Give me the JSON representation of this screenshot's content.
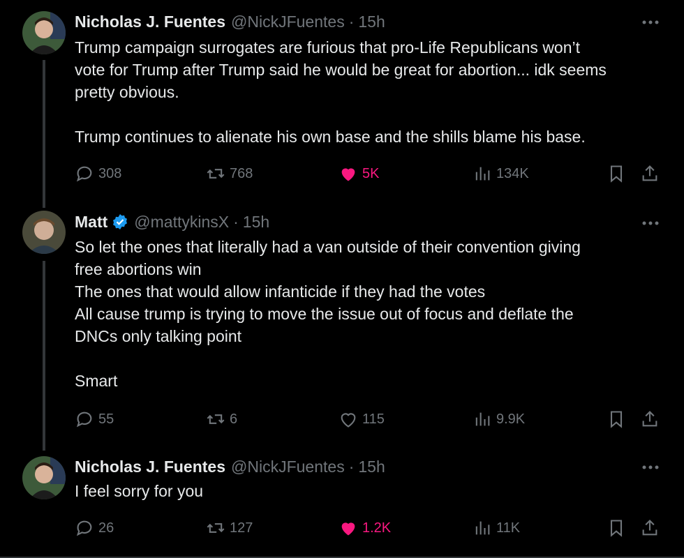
{
  "tweets": [
    {
      "name": "Nicholas J. Fuentes",
      "handle": "@NickJFuentes",
      "time": "15h",
      "lines": [
        "Trump campaign surrogates are furious that pro-Life Republicans won’t",
        "vote for Trump after Trump said he would be great for abortion... idk seems",
        "pretty obvious.",
        "",
        "Trump continues to alienate his own base and the shills blame his base."
      ],
      "replies": "308",
      "reposts": "768",
      "likes": "5K",
      "views": "134K",
      "liked": true
    },
    {
      "name": "Matt",
      "handle": "@mattykinsX",
      "time": "15h",
      "verified": true,
      "lines": [
        "So let the ones that literally had a van outside of their convention giving",
        "free abortions win",
        "The ones that would allow infanticide if they had the votes",
        "All cause trump is trying to move the issue out of focus and deflate the",
        "DNCs only talking point",
        "",
        "Smart"
      ],
      "replies": "55",
      "reposts": "6",
      "likes": "115",
      "views": "9.9K",
      "liked": false
    },
    {
      "name": "Nicholas J. Fuentes",
      "handle": "@NickJFuentes",
      "time": "15h",
      "lines": [
        "I feel sorry for you"
      ],
      "replies": "26",
      "reposts": "127",
      "likes": "1.2K",
      "views": "11K",
      "liked": true
    }
  ],
  "meta": {
    "separator": "·"
  },
  "icons": [
    "avatar",
    "verified-badge-icon",
    "more-icon",
    "reply-icon",
    "repost-icon",
    "like-icon",
    "views-icon",
    "bookmark-icon",
    "share-icon"
  ],
  "colors": {
    "background": "#000000",
    "text": "#e7e9ea",
    "muted": "#71767b",
    "like": "#f91880",
    "verified": "#1d9bf0"
  }
}
